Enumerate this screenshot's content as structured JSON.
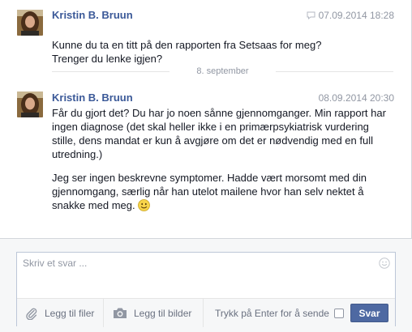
{
  "thread": {
    "messages": [
      {
        "author": "Kristin B. Bruun",
        "timestamp": "07.09.2014 18:28",
        "has_chat_icon": true,
        "paragraphs": [
          "Kunne du ta en titt på den rapporten fra Setsaas for meg?\nTrenger du lenke igjen?"
        ]
      },
      {
        "author": "Kristin B. Bruun",
        "timestamp": "08.09.2014 20:30",
        "has_chat_icon": false,
        "paragraphs": [
          "Får du gjort det? Du har jo noen sånne gjennomganger. Min rapport har ingen diagnose (det skal heller ikke i en primærpsykiatrisk vurdering stille, dens mandat er kun å avgjøre om det er nødvendig  med en full utredning.)",
          "Jeg ser ingen beskrevne symptomer. Hadde vært morsomt med din gjennomgang, særlig når han utelot mailene hvor han selv nektet å snakke med meg."
        ],
        "trailing_icon": "smiley-icon"
      }
    ],
    "date_divider": "8. september"
  },
  "composer": {
    "placeholder": "Skriv et svar ...",
    "value": "",
    "attach_files_label": "Legg til filer",
    "attach_photos_label": "Legg til bilder",
    "enter_to_send_label": "Trykk på Enter for å sende",
    "enter_to_send_checked": false,
    "send_label": "Svar"
  },
  "colors": {
    "author_link": "#3b5998",
    "send_button": "#4e69a2",
    "meta_text": "#9197a3"
  }
}
